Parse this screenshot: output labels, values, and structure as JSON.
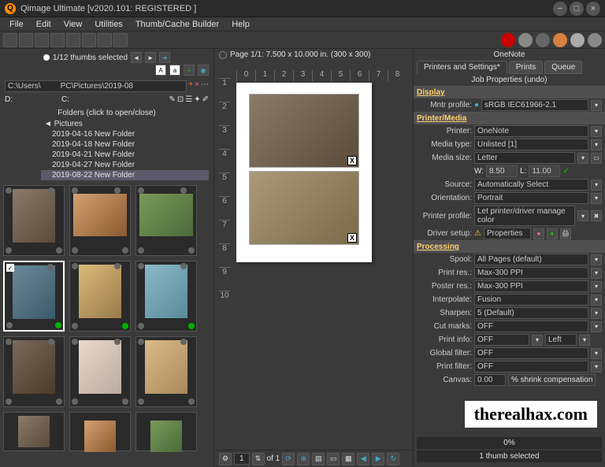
{
  "title": "Qimage Ultimate [v2020.101: REGISTERED ]",
  "menu": {
    "file": "File",
    "edit": "Edit",
    "view": "View",
    "utilities": "Utilities",
    "thumb": "Thumb/Cache Builder",
    "help": "Help"
  },
  "left": {
    "selected": "1/12 thumbs selected",
    "path": "C:\\Users\\         PC\\Pictures\\2019-08",
    "drive_d": "D:",
    "drive_c": "C:",
    "folders_hdr": "Folders (click to open/close)",
    "root": "Pictures",
    "folders": [
      "2019-04-16 New Folder",
      "2019-04-18 New Folder",
      "2019-04-21 New Folder",
      "2019-04-27 New Folder",
      "2019-08-22 New Folder"
    ]
  },
  "center": {
    "page_info": "Page 1/1: 7.500 x 10.000 in.  (300 x 300)",
    "pagenum": "1",
    "of": "of 1"
  },
  "right": {
    "hdr": "OneNote",
    "tabs": {
      "t1": "Printers and Settings*",
      "t2": "Prints",
      "t3": "Queue"
    },
    "sub": "Job Properties (undo)",
    "display": {
      "hdr": "Display",
      "mntr_lbl": "Mntr profile:",
      "mntr_val": "sRGB IEC61966-2.1"
    },
    "media": {
      "hdr": "Printer/Media",
      "printer_lbl": "Printer:",
      "printer_val": "OneNote",
      "type_lbl": "Media type:",
      "type_val": "Unlisted [1]",
      "size_lbl": "Media size:",
      "size_val": "Letter",
      "w_lbl": "W:",
      "w_val": "8.50",
      "l_lbl": "L:",
      "l_val": "11.00",
      "source_lbl": "Source:",
      "source_val": "Automatically Select",
      "orient_lbl": "Orientation:",
      "orient_val": "Portrait",
      "profile_lbl": "Printer profile:",
      "profile_val": "Let printer/driver manage color",
      "driver_lbl": "Driver setup:",
      "driver_val": "Properties"
    },
    "processing": {
      "hdr": "Processing",
      "spool_lbl": "Spool:",
      "spool_val": "All Pages (default)",
      "printres_lbl": "Print res.:",
      "printres_val": "Max-300 PPI",
      "poster_lbl": "Poster res.:",
      "poster_val": "Max-300 PPI",
      "interp_lbl": "Interpolate:",
      "interp_val": "Fusion",
      "sharpen_lbl": "Sharpen:",
      "sharpen_val": "5 (Default)",
      "cut_lbl": "Cut marks:",
      "cut_val": "OFF",
      "info_lbl": "Print info:",
      "info_val": "OFF",
      "info_pos": "Left",
      "global_lbl": "Global filter:",
      "global_val": "OFF",
      "filter_lbl": "Print filter:",
      "filter_val": "OFF",
      "canvas_lbl": "Canvas:",
      "canvas_val": "0.00",
      "canvas_unit": "% shrink compensation"
    },
    "progress": "0%",
    "status": "1 thumb selected"
  },
  "watermark": "therealhax.com"
}
